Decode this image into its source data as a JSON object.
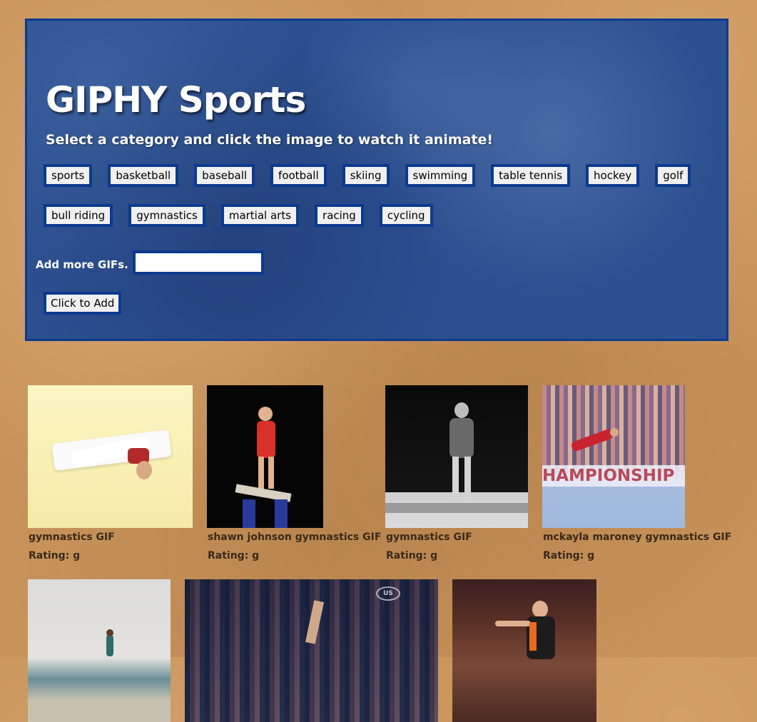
{
  "header": {
    "title": "GIPHY Sports",
    "subtitle": "Select a category and click the image to watch it animate!"
  },
  "categories": {
    "row1": [
      "sports",
      "basketball",
      "baseball",
      "football",
      "skiing",
      "swimming",
      "table tennis",
      "hockey",
      "golf"
    ],
    "row2": [
      "bull riding",
      "gymnastics",
      "martial arts",
      "racing",
      "cycling"
    ]
  },
  "add_form": {
    "label": "Add more GIFs.",
    "input_value": "",
    "button_label": "Click to Add"
  },
  "gifs": [
    {
      "title": "gymnastics GIF",
      "rating": "Rating: g"
    },
    {
      "title": "shawn johnson gymnastics GIF",
      "rating": "Rating: g"
    },
    {
      "title": "gymnastics GIF",
      "rating": "Rating: g"
    },
    {
      "title": "mckayla maroney gymnastics GIF",
      "rating": "Rating: g"
    },
    {
      "title": "",
      "rating": ""
    },
    {
      "title": "",
      "rating": ""
    },
    {
      "title": "",
      "rating": ""
    }
  ],
  "image_text": {
    "banner": "HAMPIONSHIP",
    "watermark": "US"
  },
  "colors": {
    "jumbotron_bg": "#2c4f8f",
    "jumbotron_border": "#0b3a8f",
    "page_bg": "#c8935a",
    "button_bg": "#f0f0f0"
  }
}
